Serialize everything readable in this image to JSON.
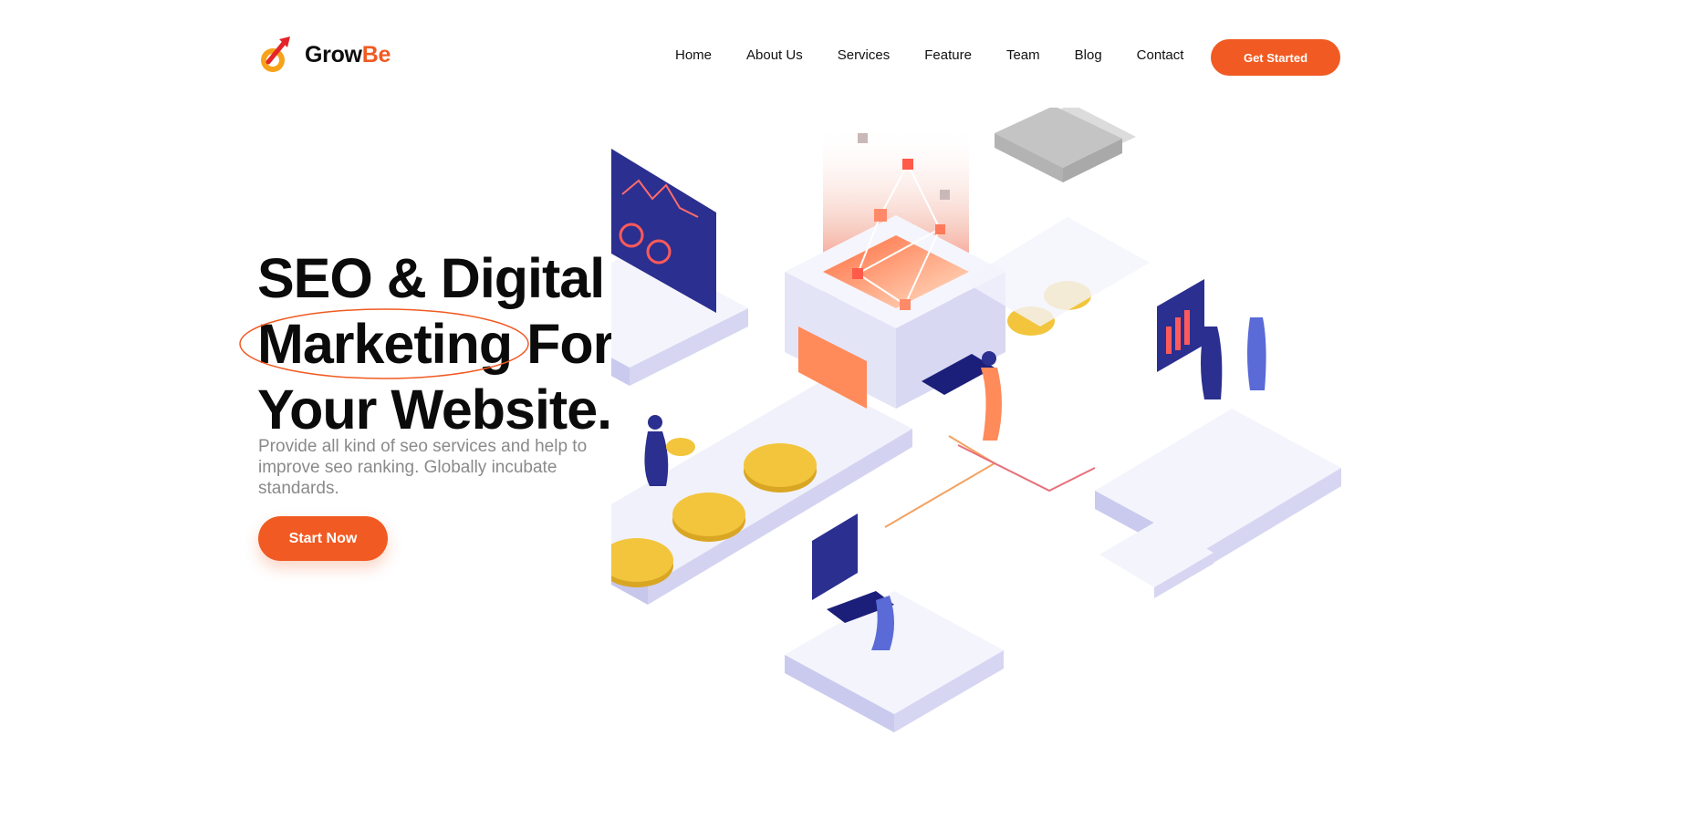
{
  "brand": {
    "name_part1": "Grow",
    "name_part2": "Be",
    "accent": "#f15a22",
    "logo_icon": "rocket-arrow-icon"
  },
  "nav": {
    "items": [
      "Home",
      "About Us",
      "Services",
      "Feature",
      "Team",
      "Blog",
      "Contact"
    ],
    "cta_label": "Get Started"
  },
  "hero": {
    "title_line1": "SEO & Digital",
    "title_highlight": "Marketing",
    "title_line2_rest": "For",
    "title_line3": "Your Website.",
    "subtitle": "Provide all kind of seo services and help to improve seo ranking. Globally incubate standards.",
    "button_label": "Start Now"
  },
  "colors": {
    "accent": "#f15a22",
    "navy": "#2b2f8f",
    "coin": "#f2c53d",
    "platform": "#eeeefb"
  }
}
